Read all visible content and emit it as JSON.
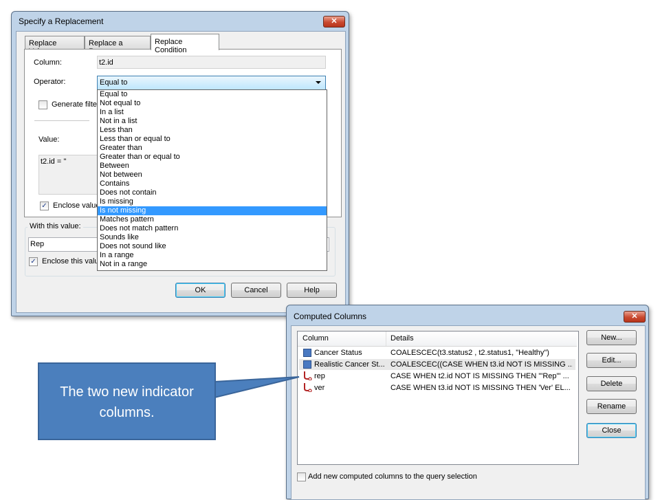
{
  "dialog_replacement": {
    "title": "Specify a Replacement",
    "close_label": "✕",
    "tabs": [
      "Replace Values",
      "Replace a Range",
      "Replace Condition"
    ],
    "column_label": "Column:",
    "column_value": "t2.id",
    "operator_label": "Operator:",
    "operator_value": "Equal to",
    "generate_filter_label": "Generate filter",
    "value_label": "Value:",
    "value_text": "t2.id = ''",
    "enclose_value_label": "Enclose value",
    "with_this_value_label": "With this value:",
    "with_this_value": "Rep",
    "enclose_this_value_label": "Enclose this valu",
    "ok_label": "OK",
    "cancel_label": "Cancel",
    "help_label": "Help"
  },
  "operator_options": [
    "Equal to",
    "Not equal to",
    "In a list",
    "Not in a list",
    "Less than",
    "Less than or equal to",
    "Greater than",
    "Greater than or equal to",
    "Between",
    "Not between",
    "Contains",
    "Does not contain",
    "Is missing",
    "Is not missing",
    "Matches pattern",
    "Does not match pattern",
    "Sounds like",
    "Does not sound like",
    "In a range",
    "Not in a range"
  ],
  "operator_highlighted": "Is not missing",
  "dialog_computed": {
    "title": "Computed Columns",
    "close_label": "✕",
    "col_header": "Column",
    "details_header": "Details",
    "rows": [
      {
        "name": "Cancer Status",
        "details": "COALESCEC(t3.status2 , t2.status1, \"Healthy\")",
        "icon": "computed-column-icon"
      },
      {
        "name": "Realistic Cancer St...",
        "details": "COALESCEC((CASE WHEN t3.id NOT IS MISSING ...",
        "icon": "computed-column-icon"
      },
      {
        "name": "rep",
        "details": "CASE WHEN t2.id NOT IS MISSING THEN \"'Rep'\" ...",
        "icon": "indicator-column-icon"
      },
      {
        "name": "ver",
        "details": "CASE WHEN t3.id NOT IS MISSING THEN 'Ver' EL...",
        "icon": "indicator-column-icon"
      }
    ],
    "new_label": "New...",
    "edit_label": "Edit...",
    "delete_label": "Delete",
    "rename_label": "Rename",
    "close_button_label": "Close",
    "add_to_query_label": "Add new computed columns to the query selection"
  },
  "callout": {
    "text": "The two new indicator columns."
  },
  "colors": {
    "title_bar": "#bfd3e8",
    "callout_fill": "#4b7fbd",
    "selection": "#3399ff"
  }
}
